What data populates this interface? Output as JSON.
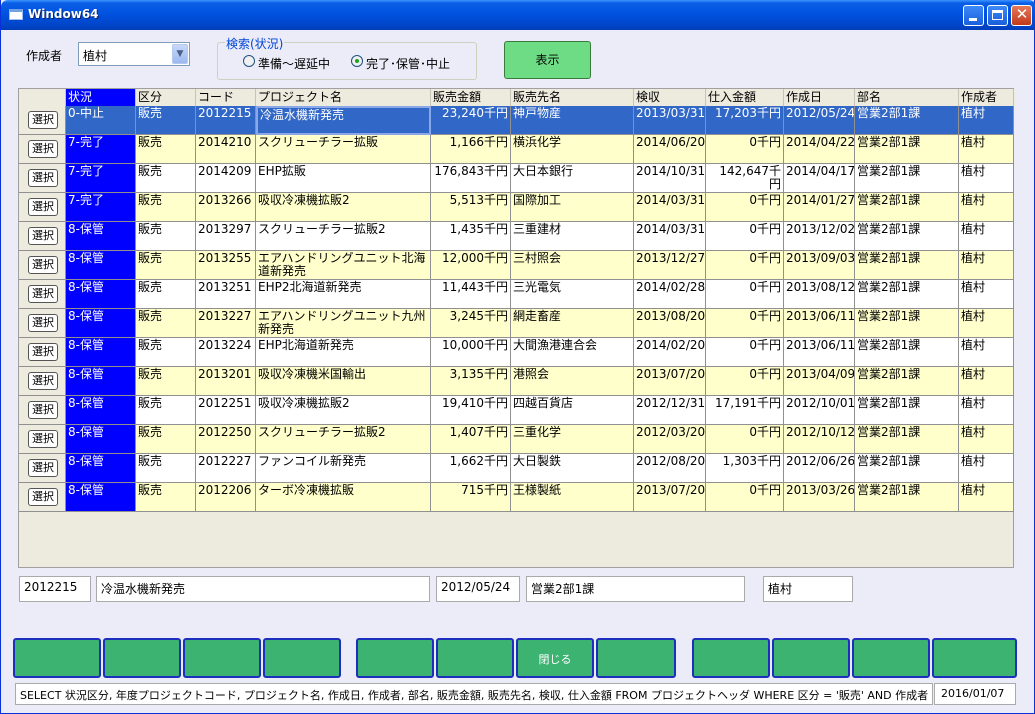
{
  "window": {
    "title": "Window64"
  },
  "filter": {
    "author_label": "作成者",
    "author_value": "植村",
    "search_group_label": "検索(状況)",
    "radio_options": [
      {
        "label": "準備〜遅延中",
        "checked": false
      },
      {
        "label": "完了･保管･中止",
        "checked": true
      }
    ],
    "show_button": "表示"
  },
  "grid": {
    "select_label": "選択",
    "columns": [
      "状況",
      "区分",
      "コード",
      "プロジェクト名",
      "販売金額",
      "販売先名",
      "検収",
      "仕入金額",
      "作成日",
      "部名",
      "作成者"
    ],
    "rows": [
      [
        "0-中止",
        "販売",
        "2012215",
        "冷温水機新発売",
        "23,240千円",
        "神戸物産",
        "2013/03/31",
        "17,203千円",
        "2012/05/24",
        "営業2部1課",
        "植村"
      ],
      [
        "7-完了",
        "販売",
        "2014210",
        "スクリューチラー拡販",
        "1,166千円",
        "横浜化学",
        "2014/06/20",
        "0千円",
        "2014/04/22",
        "営業2部1課",
        "植村"
      ],
      [
        "7-完了",
        "販売",
        "2014209",
        "EHP拡販",
        "176,843千円",
        "大日本銀行",
        "2014/10/31",
        "142,647千円",
        "2014/04/17",
        "営業2部1課",
        "植村"
      ],
      [
        "7-完了",
        "販売",
        "2013266",
        "吸収冷凍機拡販2",
        "5,513千円",
        "国際加工",
        "2014/03/31",
        "0千円",
        "2014/01/27",
        "営業2部1課",
        "植村"
      ],
      [
        "8-保管",
        "販売",
        "2013297",
        "スクリューチラー拡販2",
        "1,435千円",
        "三重建材",
        "2014/03/31",
        "0千円",
        "2013/12/02",
        "営業2部1課",
        "植村"
      ],
      [
        "8-保管",
        "販売",
        "2013255",
        "エアハンドリングユニット北海道新発売",
        "12,000千円",
        "三村照会",
        "2013/12/27",
        "0千円",
        "2013/09/03",
        "営業2部1課",
        "植村"
      ],
      [
        "8-保管",
        "販売",
        "2013251",
        "EHP2北海道新発売",
        "11,443千円",
        "三光電気",
        "2014/02/28",
        "0千円",
        "2013/08/12",
        "営業2部1課",
        "植村"
      ],
      [
        "8-保管",
        "販売",
        "2013227",
        "エアハンドリングユニット九州新発売",
        "3,245千円",
        "網走畜産",
        "2013/08/20",
        "0千円",
        "2013/06/11",
        "営業2部1課",
        "植村"
      ],
      [
        "8-保管",
        "販売",
        "2013224",
        "EHP北海道新発売",
        "10,000千円",
        "大間漁港連合会",
        "2014/02/20",
        "0千円",
        "2013/06/11",
        "営業2部1課",
        "植村"
      ],
      [
        "8-保管",
        "販売",
        "2013201",
        "吸収冷凍機米国輸出",
        "3,135千円",
        "港照会",
        "2013/07/20",
        "0千円",
        "2013/04/09",
        "営業2部1課",
        "植村"
      ],
      [
        "8-保管",
        "販売",
        "2012251",
        "吸収冷凍機拡販2",
        "19,410千円",
        "四越百貨店",
        "2012/12/31",
        "17,191千円",
        "2012/10/01",
        "営業2部1課",
        "植村"
      ],
      [
        "8-保管",
        "販売",
        "2012250",
        "スクリューチラー拡販2",
        "1,407千円",
        "三重化学",
        "2012/03/20",
        "0千円",
        "2012/10/12",
        "営業2部1課",
        "植村"
      ],
      [
        "8-保管",
        "販売",
        "2012227",
        "ファンコイル新発売",
        "1,662千円",
        "大日製鉄",
        "2012/08/20",
        "1,303千円",
        "2012/06/26",
        "営業2部1課",
        "植村"
      ],
      [
        "8-保管",
        "販売",
        "2012206",
        "ターボ冷凍機拡販",
        "715千円",
        "王様製紙",
        "2013/07/20",
        "0千円",
        "2013/03/26",
        "営業2部1課",
        "植村"
      ]
    ]
  },
  "detail": {
    "code": "2012215",
    "project": "冷温水機新発売",
    "date": "2012/05/24",
    "dept": "営業2部1課",
    "author": "植村"
  },
  "function_keys": [
    "",
    "",
    "",
    "",
    "",
    "",
    "閉じる",
    "",
    "",
    "",
    "",
    ""
  ],
  "status_bar": {
    "sql": "SELECT 状況区分, 年度プロジェクトコード, プロジェクト名, 作成日, 作成者, 部名, 販売金額, 販売先名, 検収, 仕入金額 FROM プロジェクトヘッダ WHERE 区分 = '販売'  AND 作成者 = '植",
    "date": "2016/01/07"
  },
  "colors": {
    "status_blue": "#0000ff",
    "selected_row": "#3167c6",
    "row_yellow": "#ffffcc",
    "button_green": "#6ddc84",
    "fkey_green": "#3cb371"
  }
}
